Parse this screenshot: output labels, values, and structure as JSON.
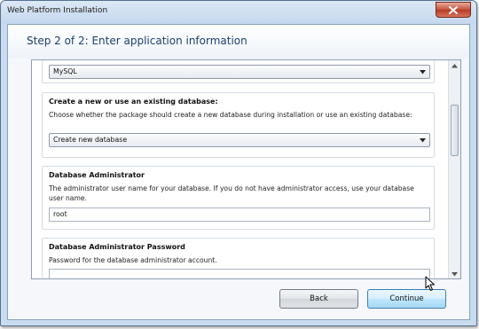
{
  "window": {
    "title": "Web Platform Installation",
    "close_icon": "close-icon"
  },
  "step": {
    "title": "Step 2 of 2: Enter application information"
  },
  "fields": {
    "db_type": {
      "value": "MySQL"
    },
    "create_db": {
      "title": "Create a new or use an existing database:",
      "description": "Choose whether the package should create a new database during installation or use an existing database:",
      "value": "Create new database"
    },
    "db_admin": {
      "title": "Database Administrator",
      "description": "The administrator user name for your database. If you do not have administrator access, use your database user name.",
      "value": "root"
    },
    "db_admin_password": {
      "title": "Database Administrator Password",
      "description": "Password for the database administrator account.",
      "value": ""
    }
  },
  "buttons": {
    "back": "Back",
    "continue": "Continue"
  },
  "icons": {
    "dropdown": "chevron-down-icon",
    "cursor": "mouse-pointer-icon"
  }
}
